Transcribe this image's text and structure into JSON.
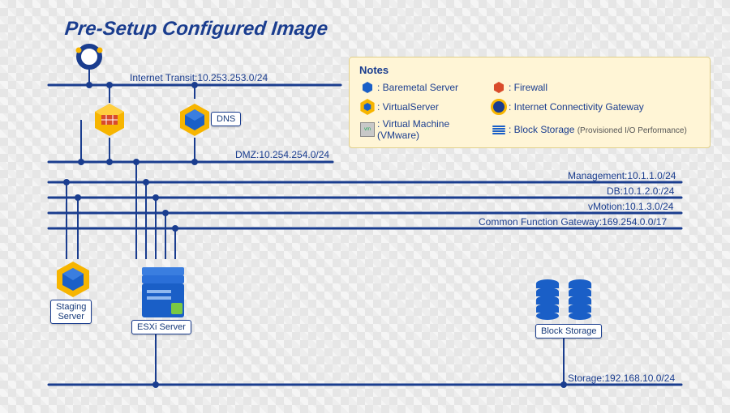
{
  "title": "Pre-Setup Configured Image",
  "networks": {
    "internet_transit": "Internet Transit:10.253.253.0/24",
    "dmz": "DMZ:10.254.254.0/24",
    "management": "Management:10.1.1.0/24",
    "db": "DB:10.1.2.0:/24",
    "vmotion": "vMotion:10.1.3.0/24",
    "cfg": "Common Function Gateway:169.254.0.0/17",
    "storage": "Storage:192.168.10.0/24"
  },
  "nodes": {
    "dns": "DNS",
    "staging": "Staging\nServer",
    "esxi": "ESXi Server",
    "block_storage": "Block Storage"
  },
  "legend": {
    "title": "Notes",
    "baremetal": ": Baremetal Server",
    "firewall": ": Firewall",
    "virtual_server": ": VirtualServer",
    "icg": ": Internet Connectivity Gateway",
    "vmware": ": Virtual Machine (VMware)",
    "block_storage": ": Block Storage",
    "block_storage_note": "(Provisioned I/O Performance)"
  }
}
